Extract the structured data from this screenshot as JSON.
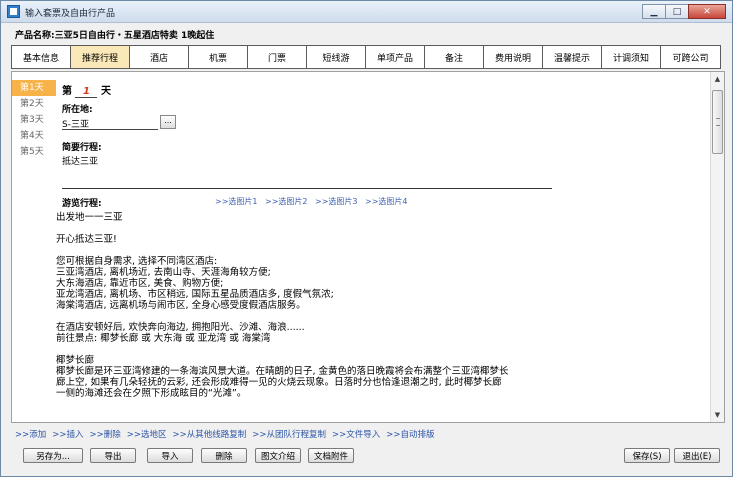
{
  "window": {
    "title": "输入套票及自由行产品"
  },
  "product": {
    "label": "产品名称:三亚5日自由行・五星酒店特卖  1晚起住"
  },
  "tabs": [
    {
      "label": "基本信息"
    },
    {
      "label": "推荐行程",
      "active": true
    },
    {
      "label": "酒店"
    },
    {
      "label": "机票"
    },
    {
      "label": "门票"
    },
    {
      "label": "短线游"
    },
    {
      "label": "单项产品"
    },
    {
      "label": "备注"
    },
    {
      "label": "费用说明"
    },
    {
      "label": "温馨提示"
    },
    {
      "label": "计调须知"
    },
    {
      "label": "可跨公司"
    }
  ],
  "days": [
    "第1天",
    "第2天",
    "第3天",
    "第4天",
    "第5天"
  ],
  "day_header": {
    "prefix": "第",
    "number": "1",
    "suffix": "天"
  },
  "location": {
    "label": "所在地:",
    "value": "S-三亚",
    "browse": "..."
  },
  "brief": {
    "label": "简要行程:",
    "value": "抵达三亚"
  },
  "tour": {
    "label": "游览行程:",
    "pic_links": [
      ">>选图片1",
      ">>选图片2",
      ">>选图片3",
      ">>选图片4"
    ]
  },
  "itinerary": [
    [
      "出发地一一三亚"
    ],
    [
      "开心抵达三亚!"
    ],
    [
      "您可根据自身需求, 选择不同湾区酒店:",
      "三亚湾酒店, 离机场近, 去南山寺、天涯海角较方便;",
      "大东海酒店, 靠近市区, 美食、购物方便;",
      "亚龙湾酒店, 离机场、市区稍远, 国际五星品质酒店多, 度假气氛浓;",
      "海棠湾酒店, 远离机场与闹市区, 全身心感受度假酒店服务。"
    ],
    [
      "在酒店安顿好后, 欢快奔向海边, 拥抱阳光、沙滩、海浪......",
      "前往景点: 椰梦长廊 或 大东海 或 亚龙湾 或 海棠湾"
    ],
    [
      "椰梦长廊",
      "椰梦长廊是环三亚湾修建的一条海滨风景大道。在晴朗的日子, 金黄色的落日晚霞将会布满整个三亚湾椰梦长",
      "廊上空, 如果有几朵轻抚的云彩, 还会形成难得一见的火烧云现象。日落时分也恰逢退潮之时, 此时椰梦长廊",
      "一侧的海滩还会在夕照下形成眩目的“光滩”。"
    ]
  ],
  "actions": [
    ">>添加",
    ">>插入",
    ">>删除",
    ">>选地区",
    ">>从其他线路复制",
    ">>从团队行程复制",
    ">>文件导入",
    ">>自动排版"
  ],
  "buttons": {
    "save_as": "另存为...",
    "export": "导出",
    "import": "导入",
    "delete": "删除",
    "pic_intro": "图文介绍",
    "doc_attach": "文档附件",
    "save": "保存(S)",
    "exit": "退出(E)"
  }
}
